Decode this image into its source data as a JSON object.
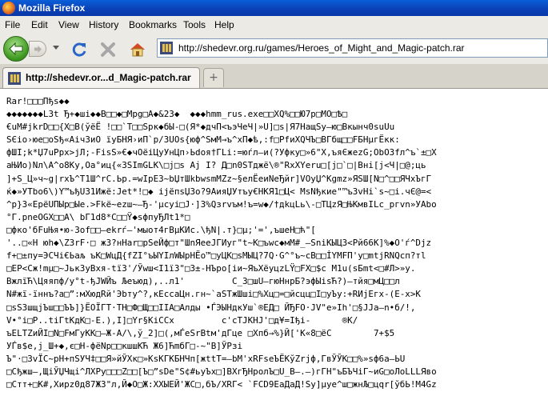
{
  "window": {
    "title": "Mozilla Firefox"
  },
  "menu": [
    "File",
    "Edit",
    "View",
    "History",
    "Bookmarks",
    "Tools",
    "Help"
  ],
  "toolbar": {
    "back_icon": "back-arrow-icon",
    "forward_icon": "forward-arrow-icon",
    "reload_icon": "reload-icon",
    "stop_icon": "stop-icon",
    "home_icon": "home-icon",
    "url": "http://shedevr.org.ru/games/Heroes_of_Might_and_Magic-patch.rar"
  },
  "tab": {
    "label": "http://shedevr.or...d_Magic-patch.rar",
    "newtab": "+"
  },
  "content_lines": [
    "Rar!□□□Пђs◆◆",
    "◆◆◆◆◆◆◆L3t Ђ+◆шi◆◆B□□◆□Mpg□A◆&23◆  ◆◆◆hmm_rus.exe□□XQ%□□Ю7p□MO□Ѣ□",
    "€uM#jkrD□□{X□B(ўёЁ !□□`Т□□Spк◆бЫ-□(Я*◆дчП<ъэЧеЧ|»U]□s|Я7НащSу—ю□Вкынч0suUu",
    "SЄio›юe□oSђ«Аiч3иО їуБНЯ›иП`p/ЗUOs{юф^ЅмМ→ъ^хП◆ѣ,:f□РfиXQЧЪ□BГбщ□□FБНµгЁкк:",
    "фШI;k*Џ7uPpx>jЛ;-FisS»€◆чОёiЦуУнЦп›Ьdoя†ГLi:=юѓл—и(?Уфку□»6\"X,ъяЄжеzG;ОbО3fл^ъ`±□X",
    "аЊИо)Nл\\А^о8Ку,Оа°иц{«ЗSImGLK\\□ј□s Aј I? Д□n0SТджё\\®\"RxXYeru□[ј□`□|Вні[ј<Ч|□@;ць",
    "]+S_Ц»ч~g|rхЪ^T1Ш^rС.Ьр.=wІрЕ3~bЏтШkbwsmМZz~§eлЁеиNeЂйr]VОуЏ^Кgmz»ЯSШ[N□^□□ЯЧхЪгГ",
    "ќ◆»УТbо6\\)Y™ъђU31Ижё:Jеt*!□◆ ijёпsЏЗо?9АияЏУтъу€НКЯ1□Ц< МsNђкие\"™ъ3vНі`s~□i.чЄ@=<",
    "^p}3«ЕрёUПЫр□Ые.>Fkё~ezш~—Ђ-'µсуi□J·]3%Qзrvъм!ъ=w◆/†дkцLь\\-□ТЦzЯ□ЊКмвILc_ргvn»УАbо",
    "°Г.pneОGX□□А\\ bГ1d8*С□□Ÿ◆sфпуЂЛt1*□",
    "□фко'бFuЊя•ю-3оf□□—еkrѓ—'мыот4гВµКИс.\\ђN|.т}□µ;'=',ъшеН□ћ\"[",
    "'..□«Н юh◆\\Z3rF·□ ж3?нНаr□рЅеЙф□т\"ШnЯееJГИуг\"t~К□ъwс◆мМ#_—SniКЫЦЗ<Рй66К]%◆О'ѓ^Djz",
    "f+□±пу=ЭСЧi€Ьаљ ъК□WцД{fZI°ъЫYIлWЫрНЁо™□уЦК□sМЫЦ?7Q·G^°ъ~сВ□□İYМFП'у□mtjRNQсп?тl",
    "□EP<Сж!mµ□~JькЗуВхя-tї3'/Ўwш<I1ї3\"□3±-НЪро[iи~ЯъХёуцzLŸ□FХ□$c М1u(sБmt<□#Л>»у.",
    "BжлїЋ\\Цяяпф/у°t-ђJWЙъ Љеъюд),..л1'         С_3□шU—гюНнрБ?эфЫiѕЋ?)—тйя□мЦ□□л",
    "N#жї-їннъ?а□”:мХюдRй'Эbту^?,кЕссаЦн.гн~`аЅТжШшi□%Хц□=□йсцц□I□уЪу:+RИјЕгх-(Е-х>К",
    "□sSЗшщјЪш□□ЪЪ]}ЁОЇГТ·ТН□Ф□Щ□□ІІА□Алды •ЃЭЫНдкУш`®ЕД□ ЙЂFО·JV\"е»Ih'□§JJа—n•б/!,",
    "V•°i□Р..tiГtКдК□-Е.),I]□Yr§KiССх         с'сТJКНJ'□д¥=Іђi-      ®К/",
    "ъЕLТZиЙI□N□FмГуКК□—Ж-А/\\,ў_2]□(,мЃеЅrВtм'дГце □Хпб→%}Й['К«8□ёС        7+$5",
    "УЃв$е,ј_Ш+◆,є□Н-фёNр□□кшшКЋ Ж6]ЋmбГ□-~\"В]ЎРзi",
    "Ъ\"·□3vЇС~рН+пSУЧ‡□□Я»йЎХк□»КsКГКБНЧп[жttТ=—bМ'хRFsеЪЁКўZrјф,ГвЎЎК□□%»sф6а—ЬU",
    "□Сђжш—,ЩіЎЏЧщі^ЛХРу□□□Z□□[Ъ□”sDе\"S¢#ьуЪх□]ВХгЂНролЪ□U_В—.—)гГН\"ъБЪЧiГ~иG□оЛоLLLЯво",
    "□Стт+□К#,Хирz0д87Ж3\"л,Й◆О□Ж:ХХЫЕЙ'ЖС□,бЪ/ХRГ< `FCD9ЕаДаД!Sу]µуе^ш□жнЉ□цqr[ўбЬ!М4Gz"
  ]
}
